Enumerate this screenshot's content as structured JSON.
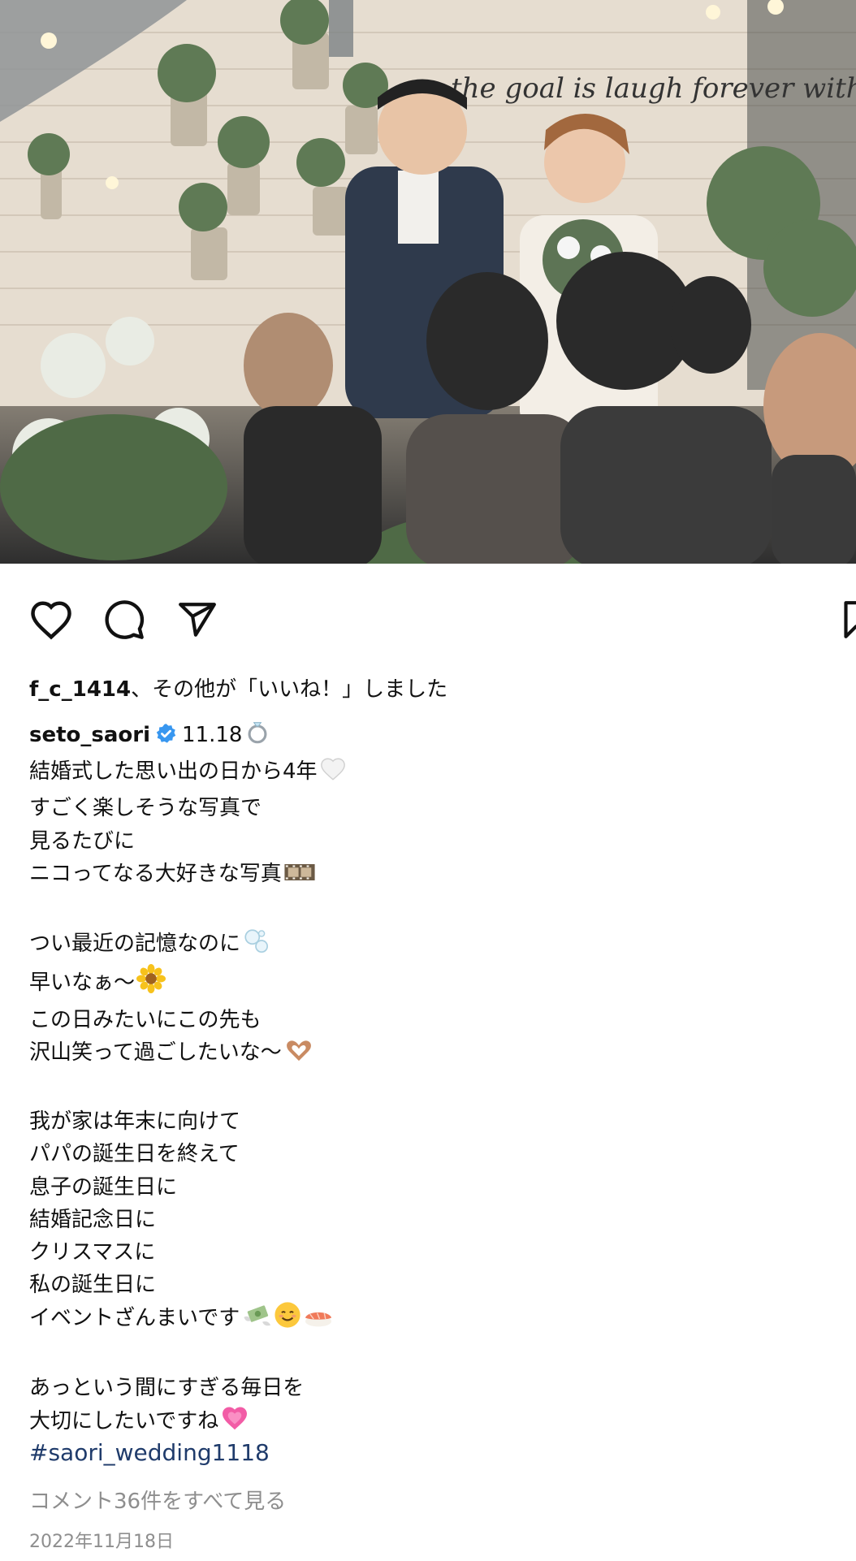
{
  "post": {
    "likes": {
      "who": "f_c_1414",
      "rest": "、その他が「いいね！」しました"
    },
    "author": "seto_saori",
    "caption_lines": [
      "11.18",
      "結婚式した思い出の日から4年",
      "すごく楽しそうな写真で",
      "見るたびに",
      "ニコってなる大好きな写真",
      "",
      "つい最近の記憶なのに",
      "早いなぁ〜",
      "この日みたいにこの先も",
      "沢山笑って過ごしたいな〜",
      "",
      "我が家は年末に向けて",
      "パパの誕生日を終えて",
      "息子の誕生日に",
      "結婚記念日に",
      "クリスマスに",
      "私の誕生日に",
      "イベントざんまいです",
      "",
      "あっという間にすぎる毎日を",
      "大切にしたいですね"
    ],
    "hashtag": "#saori_wedding1118",
    "view_comments": "コメント36件をすべて見る",
    "date": "2022年11月18日"
  },
  "photo_text": {
    "wall_script": "the goal is laugh forever with someone you really"
  },
  "icons": {
    "like": "heart-outline-icon",
    "comment": "speech-bubble-icon",
    "share": "paper-plane-icon",
    "save": "bookmark-icon",
    "verified": "verified-badge-icon"
  },
  "colors": {
    "verified": "#3897f0",
    "hashtag": "#1f3b6b",
    "muted": "#8e8e8e"
  }
}
